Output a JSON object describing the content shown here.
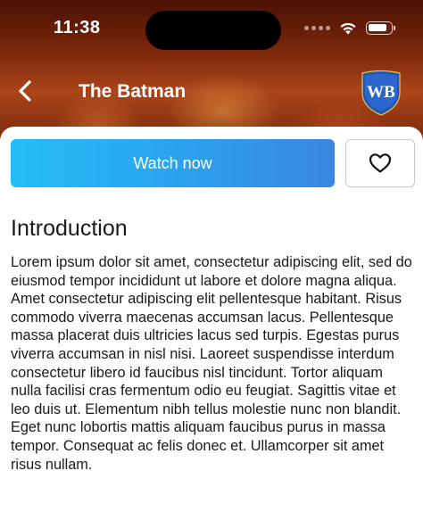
{
  "status_bar": {
    "time": "11:38",
    "battery_level": 0.85
  },
  "nav": {
    "title": "The Batman",
    "back_icon": "chevron-left-icon",
    "logo_text": "WB"
  },
  "actions": {
    "watch_label": "Watch now",
    "favorite_icon": "heart-outline-icon"
  },
  "content": {
    "section_title": "Introduction",
    "body": "Lorem ipsum dolor sit amet, consectetur adipiscing elit, sed do eiusmod tempor incididunt ut labore et dolore magna aliqua. Amet consectetur adipiscing elit pellentesque habitant. Risus commodo viverra maecenas accumsan lacus. Pellentesque massa placerat duis ultricies lacus sed turpis. Egestas purus viverra accumsan in nisl nisi. Laoreet suspendisse interdum consectetur libero id faucibus nisl tincidunt. Tortor aliquam nulla facilisi cras fermentum odio eu feugiat. Sagittis vitae et leo duis ut. Elementum nibh tellus molestie nunc non blandit. Eget nunc lobortis mattis aliquam faucibus purus in massa tempor. Consequat ac felis donec et. Ullamcorper sit amet risus nullam."
  },
  "colors": {
    "accent_start": "#24bdf8",
    "accent_end": "#3a86e0",
    "logo_blue": "#1d57b8"
  }
}
